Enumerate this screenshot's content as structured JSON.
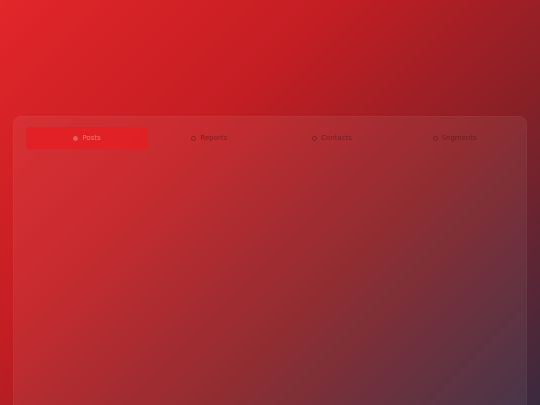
{
  "tabs": [
    {
      "label": "Posts",
      "active": true,
      "icon": "dot-icon"
    },
    {
      "label": "Reports",
      "active": false,
      "icon": "circle-icon"
    },
    {
      "label": "Contacts",
      "active": false,
      "icon": "circle-icon"
    },
    {
      "label": "Segments",
      "active": false,
      "icon": "circle-icon"
    }
  ],
  "colors": {
    "background_start": "#e2262a",
    "background_end": "#3a2a3f",
    "active_tab": "#e61e23"
  }
}
